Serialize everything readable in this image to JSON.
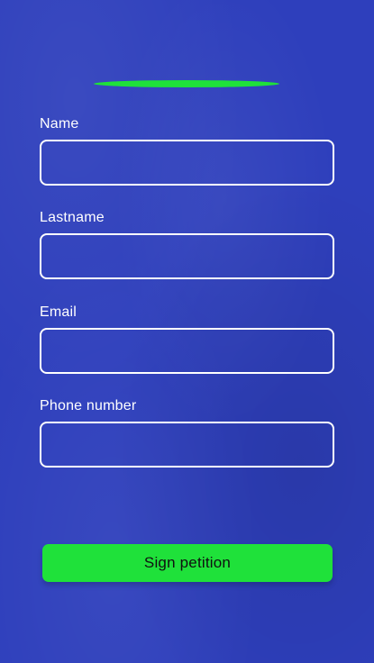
{
  "form": {
    "fields": [
      {
        "label": "Name",
        "value": "",
        "placeholder": ""
      },
      {
        "label": "Lastname",
        "value": "",
        "placeholder": ""
      },
      {
        "label": "Email",
        "value": "",
        "placeholder": ""
      },
      {
        "label": "Phone number",
        "value": "",
        "placeholder": ""
      }
    ],
    "submit_label": "Sign petition"
  },
  "colors": {
    "background": "#2e3fbc",
    "accent": "#1fe13a",
    "field_border": "#ffffff",
    "label_text": "#ffffff",
    "button_text": "#101010"
  }
}
